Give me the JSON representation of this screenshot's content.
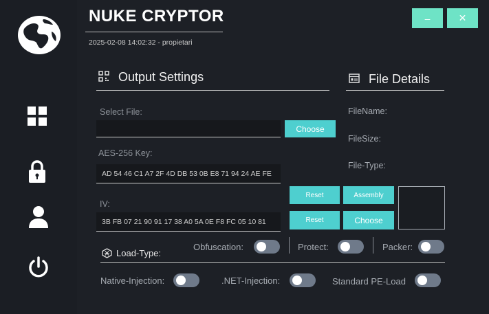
{
  "app": {
    "title": "NUKE CRYPTOR",
    "subtitle": "2025-02-08 14:02:32 - propietari"
  },
  "window_controls": {
    "minimize_label": "–",
    "close_label": "✕"
  },
  "sidebar": {
    "items": [
      {
        "name": "dashboard",
        "icon": "grid-icon"
      },
      {
        "name": "security",
        "icon": "lock-icon"
      },
      {
        "name": "user",
        "icon": "user-icon"
      },
      {
        "name": "power",
        "icon": "power-icon"
      }
    ]
  },
  "output_settings": {
    "title": "Output Settings",
    "select_file_label": "Select File:",
    "select_file_value": "",
    "choose_label": "Choose",
    "aes_label": "AES-256 Key:",
    "aes_value": "AD 54 46 C1 A7 2F 4D DB 53 0B E8 71 94 24 AE FE",
    "iv_label": "IV:",
    "iv_value": "3B FB 07 21 90 91 17 38 A0 5A 0E F8 FC 05 10 81"
  },
  "file_details": {
    "title": "File Details",
    "filename_label": "FileName:",
    "filesize_label": "FileSize:",
    "filetype_label": "File-Type:"
  },
  "actions": {
    "reset_label": "Reset",
    "assembly_label": "Assembly",
    "reset2_label": "Reset",
    "choose2_label": "Choose"
  },
  "load_type": {
    "title": "Load-Type:",
    "obfuscation_label": "Obfuscation:",
    "protect_label": "Protect:",
    "packer_label": "Packer:",
    "native_label": "Native-Injection:",
    "net_label": ".NET-Injection:",
    "pe_label": "Standard PE-Load"
  },
  "colors": {
    "accent": "#4ecfcf",
    "window_button": "#6ee3c6",
    "background": "#1d2026",
    "toggle_off": "#6f7a8a"
  }
}
